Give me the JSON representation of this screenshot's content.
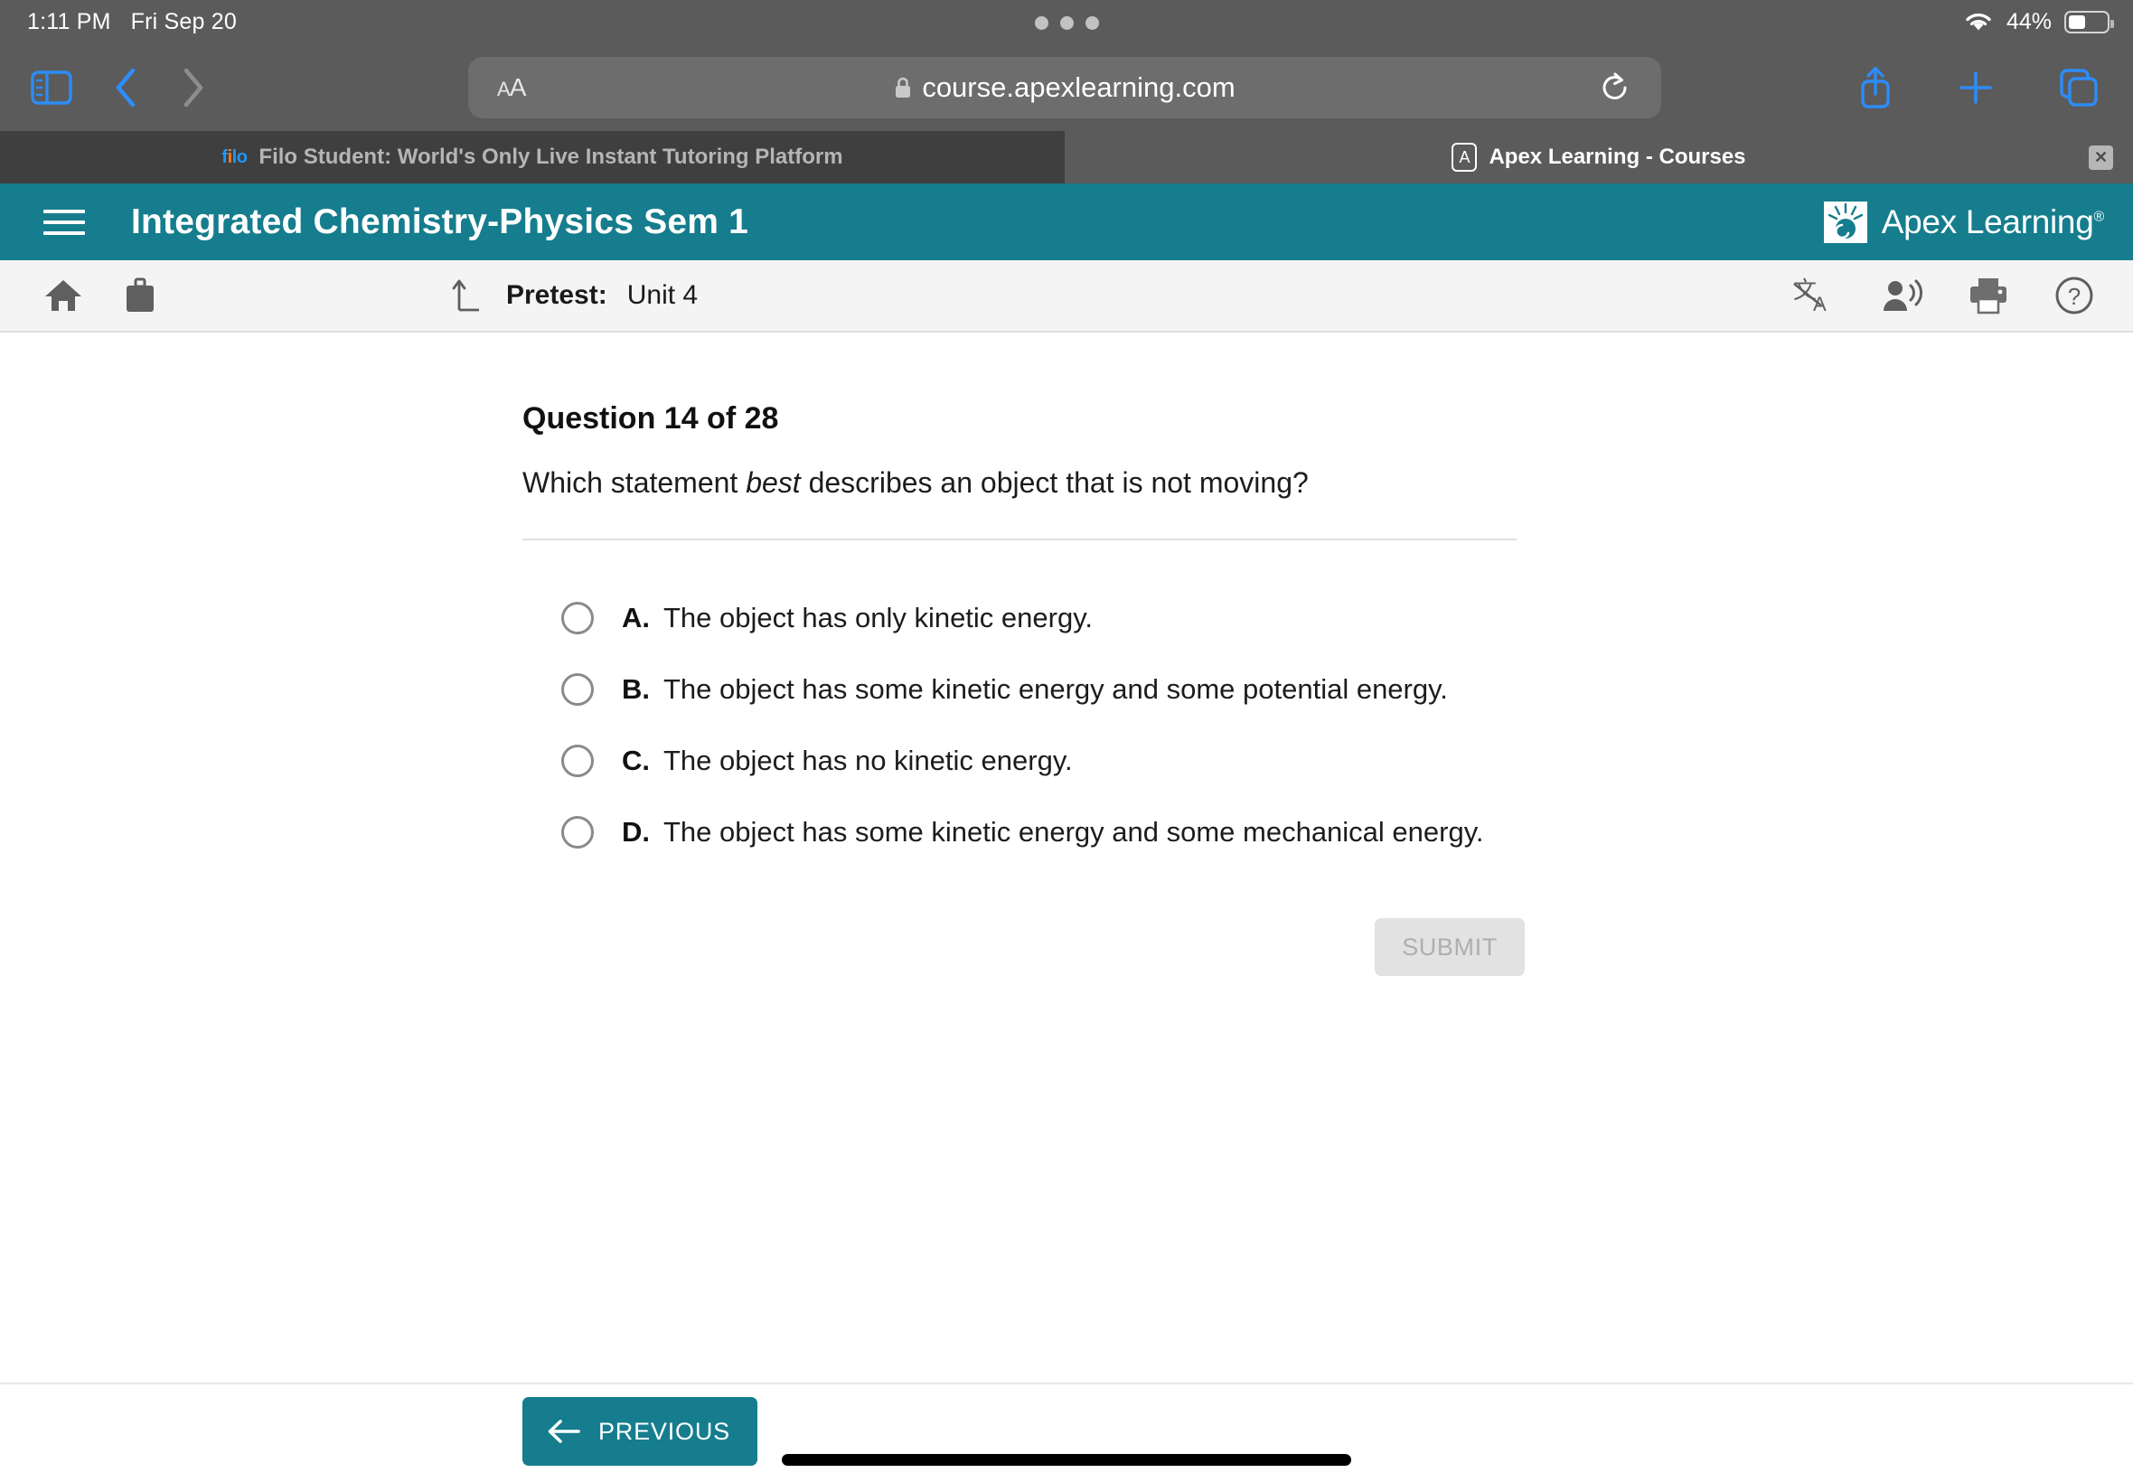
{
  "status_bar": {
    "time": "1:11 PM",
    "date": "Fri Sep 20",
    "battery_percent": "44%",
    "wifi_icon": "wifi-icon",
    "battery_icon": "battery-icon"
  },
  "browser": {
    "sidebar_icon": "sidebar-toggle-icon",
    "back_icon": "chevron-left-icon",
    "forward_icon": "chevron-right-icon",
    "text_size_label": "AA",
    "lock_icon": "lock-icon",
    "url": "course.apexlearning.com",
    "reload_icon": "reload-icon",
    "share_icon": "share-icon",
    "new_tab_icon": "plus-icon",
    "tabs_overview_icon": "tabs-icon",
    "tabs": [
      {
        "title": "Filo Student: World's Only Live Instant Tutoring Platform",
        "favicon": "filo-favicon",
        "active": false,
        "close_label": "✕"
      },
      {
        "title": "Apex Learning - Courses",
        "favicon": "apex-favicon",
        "favicon_letter": "A",
        "active": true
      }
    ]
  },
  "apex_header": {
    "menu_icon": "hamburger-menu-icon",
    "course_title": "Integrated Chemistry-Physics Sem 1",
    "brand_name": "Apex Learning",
    "brand_registered": "®",
    "brand_logo_icon": "apex-sunburst-logo-icon",
    "background_color": "#157d8d"
  },
  "subnav": {
    "home_icon": "home-icon",
    "briefcase_icon": "briefcase-icon",
    "activity_icon": "activity-up-arrow-icon",
    "activity_type": "Pretest:",
    "activity_name": "Unit 4",
    "translate_icon": "translate-icon",
    "read_aloud_icon": "read-aloud-icon",
    "print_icon": "print-icon",
    "help_icon": "help-circle-icon"
  },
  "question": {
    "number_label": "Question 14 of 28",
    "prompt_before": "Which statement ",
    "prompt_emphasis": "best",
    "prompt_after": " describes an object that is not moving?",
    "options": [
      {
        "letter": "A.",
        "text": "The object has only kinetic energy.",
        "selected": false
      },
      {
        "letter": "B.",
        "text": "The object has some kinetic energy and some potential energy.",
        "selected": false
      },
      {
        "letter": "C.",
        "text": "The object has no kinetic energy.",
        "selected": false
      },
      {
        "letter": "D.",
        "text": "The object has some kinetic energy and some mechanical energy.",
        "selected": false
      }
    ],
    "submit_label": "SUBMIT",
    "submit_disabled": true
  },
  "footer": {
    "previous_label": "PREVIOUS",
    "previous_icon": "arrow-left-icon",
    "home_indicator": "home-indicator"
  },
  "colors": {
    "teal": "#157d8d",
    "chrome_gray": "#5b5b5b",
    "tab_inactive": "#3f3f3f",
    "safari_blue": "#2d8cf8"
  }
}
